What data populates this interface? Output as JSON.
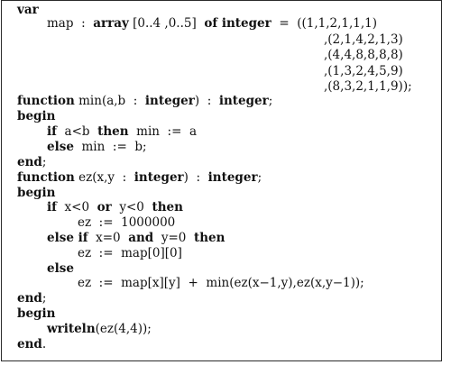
{
  "code": {
    "lines": [
      {
        "segments": [
          {
            "t": "var",
            "b": true
          }
        ]
      },
      {
        "segments": [
          {
            "t": "map  :  ",
            "b": false
          },
          {
            "t": "array",
            "b": true
          },
          {
            "t": " [0..4 ,0..5]  ",
            "b": false
          },
          {
            "t": "of integer",
            "b": true
          },
          {
            "t": "  =  ((1,1,2,1,1,1)",
            "b": false
          }
        ]
      },
      {
        "segments": [
          {
            "t": ",(2,1,4,2,1,3)",
            "b": false
          }
        ]
      },
      {
        "segments": [
          {
            "t": ",(4,4,8,8,8,8)",
            "b": false
          }
        ]
      },
      {
        "segments": [
          {
            "t": ",(1,3,2,4,5,9)",
            "b": false
          }
        ]
      },
      {
        "segments": [
          {
            "t": ",(8,3,2,1,1,9));",
            "b": false
          }
        ]
      },
      {
        "segments": [
          {
            "t": "function",
            "b": true
          },
          {
            "t": " min(a,b  :  ",
            "b": false
          },
          {
            "t": "integer",
            "b": true
          },
          {
            "t": ")  :  ",
            "b": false
          },
          {
            "t": "integer",
            "b": true
          },
          {
            "t": ";",
            "b": false
          }
        ]
      },
      {
        "segments": [
          {
            "t": "begin",
            "b": true
          }
        ]
      },
      {
        "segments": [
          {
            "t": "if",
            "b": true
          },
          {
            "t": "  a<b  ",
            "b": false
          },
          {
            "t": "then",
            "b": true
          },
          {
            "t": "  min  :=  a",
            "b": false
          }
        ]
      },
      {
        "segments": [
          {
            "t": "else",
            "b": true
          },
          {
            "t": "  min  :=  b;",
            "b": false
          }
        ]
      },
      {
        "segments": [
          {
            "t": "end",
            "b": true
          },
          {
            "t": ";",
            "b": false
          }
        ]
      },
      {
        "segments": [
          {
            "t": "function",
            "b": true
          },
          {
            "t": " ez(x,y  :  ",
            "b": false
          },
          {
            "t": "integer",
            "b": true
          },
          {
            "t": ")  :  ",
            "b": false
          },
          {
            "t": "integer",
            "b": true
          },
          {
            "t": ";",
            "b": false
          }
        ]
      },
      {
        "segments": [
          {
            "t": "begin",
            "b": true
          }
        ]
      },
      {
        "segments": [
          {
            "t": "if",
            "b": true
          },
          {
            "t": "  x<0  ",
            "b": false
          },
          {
            "t": "or",
            "b": true
          },
          {
            "t": "  y<0  ",
            "b": false
          },
          {
            "t": "then",
            "b": true
          }
        ]
      },
      {
        "segments": [
          {
            "t": "ez  :=  1000000",
            "b": false
          }
        ]
      },
      {
        "segments": [
          {
            "t": "else if",
            "b": true
          },
          {
            "t": "  x=0  ",
            "b": false
          },
          {
            "t": "and",
            "b": true
          },
          {
            "t": "  y=0  ",
            "b": false
          },
          {
            "t": "then",
            "b": true
          }
        ]
      },
      {
        "segments": [
          {
            "t": "ez  :=  map[0][0]",
            "b": false
          }
        ]
      },
      {
        "segments": [
          {
            "t": "else",
            "b": true
          }
        ]
      },
      {
        "segments": [
          {
            "t": "ez  :=  map[x][y]  +  min(ez(x−1,y),ez(x,y−1));",
            "b": false
          }
        ]
      },
      {
        "segments": [
          {
            "t": "end",
            "b": true
          },
          {
            "t": ";",
            "b": false
          }
        ]
      },
      {
        "segments": [
          {
            "t": "begin",
            "b": true
          }
        ]
      },
      {
        "segments": [
          {
            "t": "writeln",
            "b": true
          },
          {
            "t": "(ez(4,4));",
            "b": false
          }
        ]
      },
      {
        "segments": [
          {
            "t": "end",
            "b": true
          },
          {
            "t": ".",
            "b": false
          }
        ]
      }
    ]
  }
}
